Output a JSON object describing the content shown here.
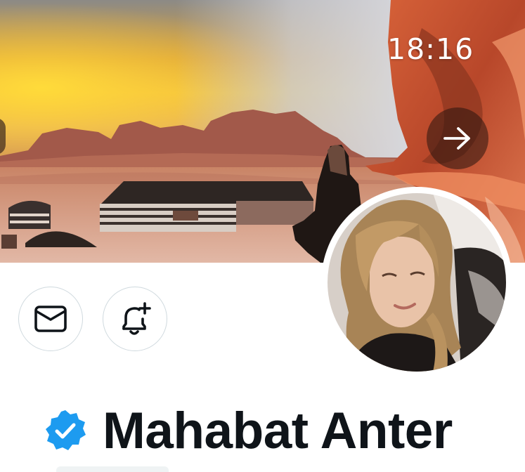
{
  "status_bar": {
    "time": "18:16"
  },
  "banner": {
    "image_description_icon": "desert-camp-banner"
  },
  "navigation": {
    "forward_icon": "arrow-right-icon"
  },
  "actions": {
    "message_icon": "mail-icon",
    "notify_icon": "bell-plus-icon"
  },
  "profile": {
    "display_name": "Mahabat Anter",
    "verified": true,
    "verified_color": "#1d9bf0"
  },
  "colors": {
    "text_primary": "#0f1419",
    "border": "#cfd9de",
    "accent": "#1d9bf0"
  }
}
